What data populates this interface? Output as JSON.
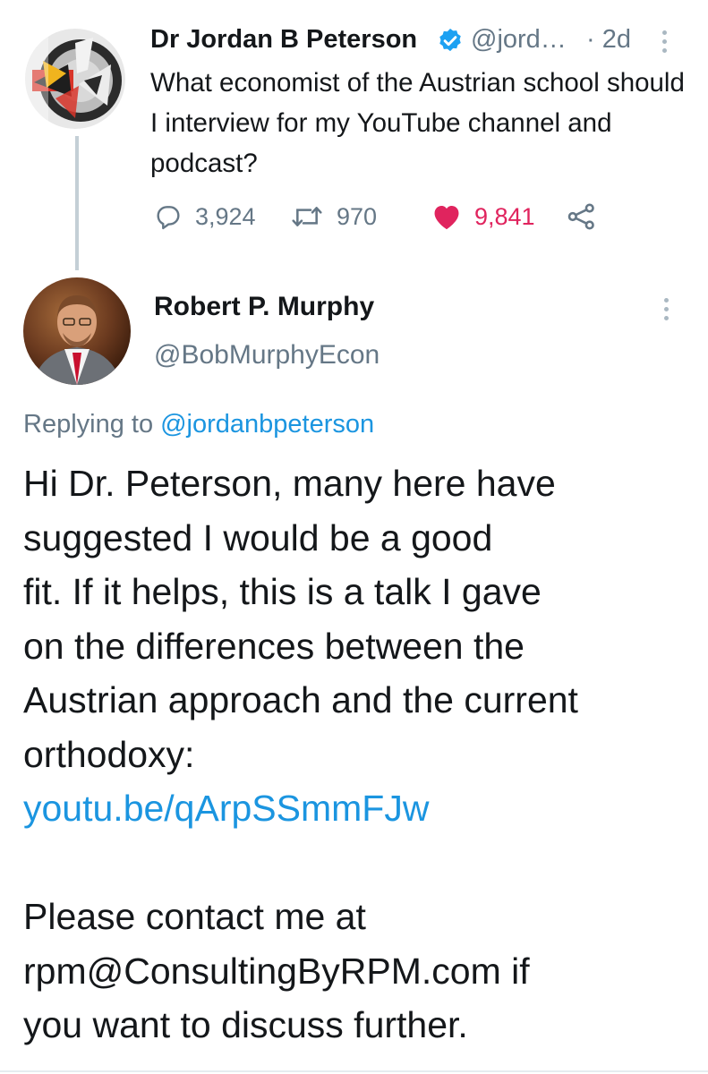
{
  "parent_tweet": {
    "display_name": "Dr Jordan B Peterson",
    "handle": "@jord…",
    "time": "· 2d",
    "text": "What economist of the Austrian school should I interview for my YouTube channel and podcast?",
    "replies": "3,924",
    "retweets": "970",
    "likes": "9,841",
    "icons": [
      "comment-icon",
      "retweet-icon",
      "heart-icon",
      "share-icon",
      "verified-badge-icon",
      "more-options-icon"
    ],
    "colors": {
      "like": "#e0245e",
      "verified": "#1da1f2",
      "secondary_text": "#657786"
    }
  },
  "reply_tweet": {
    "display_name": "Robert P. Murphy",
    "handle": "@BobMurphyEcon",
    "replying_prefix": "Replying to",
    "replying_to": "@jordanbpeterson",
    "body_lines": [
      "Hi Dr. Peterson, many here have",
      "suggested I would be a good",
      "fit. If it helps, this is a talk I gave",
      "on the differences between the",
      "Austrian approach and the current",
      "orthodoxy:"
    ],
    "link": "youtu.be/qArpSSmmFJw",
    "closing_lines": [
      "Please contact me at",
      "rpm@ConsultingByRPM.com if",
      "you want to discuss further."
    ],
    "colors": {
      "link": "#1b95e0"
    }
  }
}
